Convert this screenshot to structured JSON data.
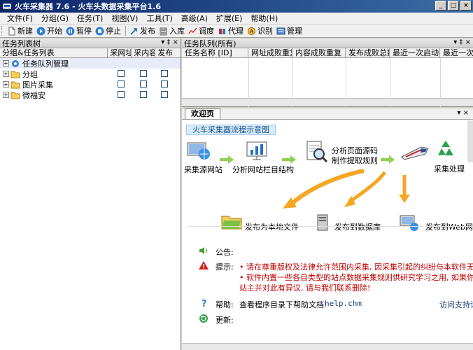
{
  "window": {
    "title": "火车采集器 7.6 - 火车头数据采集平台1.6",
    "minimize": "_",
    "maximize": "□",
    "close": "×"
  },
  "menu": [
    "文件(F)",
    "分组(G)",
    "任务(T)",
    "视图(V)",
    "工具(T)",
    "高级(A)",
    "扩展(E)",
    "帮助(H)"
  ],
  "toolbar": {
    "new": "新建",
    "start": "开始",
    "pause": "暂停",
    "stop": "停止",
    "publish": "发布",
    "import": "入库",
    "schedule": "调度",
    "proxy": "代理",
    "recognize": "识别",
    "manage": "管理"
  },
  "left_pane": {
    "title": "任务列表树",
    "pin": "▾ ‡ ×",
    "columns": [
      "分组&任务列表",
      "采网址",
      "采内容",
      "发布"
    ],
    "tree": [
      {
        "label": "任务队列管理",
        "checkboxes": false,
        "selected": true
      },
      {
        "label": "分组",
        "checkboxes": true
      },
      {
        "label": "图片采集",
        "checkboxes": true
      },
      {
        "label": "微福安",
        "checkboxes": true
      }
    ]
  },
  "queue_pane": {
    "title": "任务队列(所有)",
    "pin": "▾ ‡ ×",
    "columns": [
      "任务名称 [ID]",
      "网址成败重复",
      "内容成败重复",
      "发布成败总数",
      "最近一次启动于",
      "最近一次"
    ]
  },
  "welcome": {
    "tab": "欢迎页",
    "ctrls": "▾  ×",
    "banner": "火车采集器流程示意图",
    "steps": {
      "source": "采集源网站",
      "analyze_site": "分析网站栏目结构",
      "analyze_page_1": "分析页面源码",
      "analyze_page_2": "制作提取规则",
      "process": "采集处理",
      "local_file": "发布为本地文件",
      "database": "发布到数据库",
      "website": "发布到Web网站"
    },
    "info": {
      "notice_label": "公告:",
      "tip_label": "提示:",
      "tip_line1": "• 请在尊重版权及法律允许范围内采集, 因采集引起的纠纷与本软件无关!",
      "tip_line2": "• 软件内置一些各自类型的站点数据采集规则供研究学习之用, 如果你是网",
      "tip_line3": "站主并对此有异议, 请与我们联系删除!",
      "help_label": "帮助:",
      "help_text": "查看程序目录下帮助文档:",
      "help_file": "help.chm",
      "help_link": "访问支持论",
      "update_label": "更新:"
    }
  }
}
